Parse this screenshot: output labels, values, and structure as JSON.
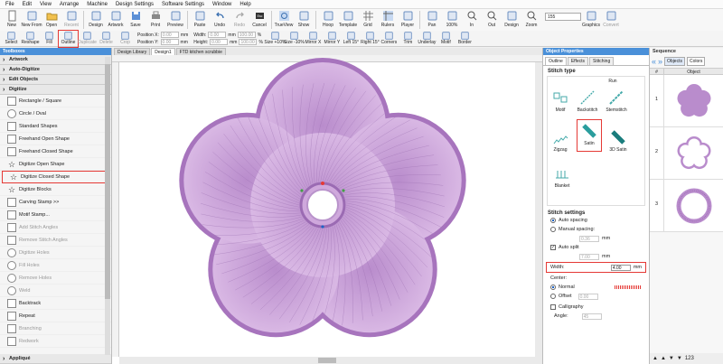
{
  "menu": [
    "File",
    "Edit",
    "View",
    "Arrange",
    "Machine",
    "Design Settings",
    "Software Settings",
    "Window",
    "Help"
  ],
  "ribbon": {
    "tools": [
      {
        "label": "New",
        "icon": "new-doc-icon"
      },
      {
        "label": "New From",
        "icon": "new-from-icon"
      },
      {
        "label": "Open",
        "icon": "open-folder-icon"
      },
      {
        "label": "Recent",
        "icon": "recent-icon"
      },
      {
        "label": "Design",
        "icon": "design-icon"
      },
      {
        "label": "Artwork",
        "icon": "artwork-icon"
      },
      {
        "label": "Save",
        "icon": "save-icon"
      },
      {
        "label": "Print",
        "icon": "print-icon"
      },
      {
        "label": "Preview",
        "icon": "preview-icon"
      },
      {
        "label": "Paste",
        "icon": "paste-icon"
      },
      {
        "label": "Undo",
        "icon": "undo-icon"
      },
      {
        "label": "Redo",
        "icon": "redo-icon"
      },
      {
        "label": "Cancel",
        "icon": "cancel-icon"
      },
      {
        "label": "TrueView",
        "icon": "trueview-icon"
      },
      {
        "label": "Show",
        "icon": "show-icon"
      },
      {
        "label": "Hoop",
        "icon": "hoop-icon"
      },
      {
        "label": "Template",
        "icon": "template-icon"
      },
      {
        "label": "Grid",
        "icon": "grid-icon"
      },
      {
        "label": "Rulers",
        "icon": "rulers-icon"
      },
      {
        "label": "Player",
        "icon": "player-icon"
      },
      {
        "label": "Pan",
        "icon": "pan-icon"
      },
      {
        "label": "100%",
        "icon": "zoom-100-icon"
      },
      {
        "label": "In",
        "icon": "zoom-in-icon"
      },
      {
        "label": "Out",
        "icon": "zoom-out-icon"
      },
      {
        "label": "Design",
        "icon": "zoom-design-icon"
      },
      {
        "label": "Zoom",
        "icon": "zoom-icon"
      }
    ],
    "zoom_value": "155",
    "extra_tools": [
      {
        "label": "Graphics",
        "icon": "graphics-icon"
      },
      {
        "label": "Convert",
        "icon": "convert-icon"
      }
    ]
  },
  "ribbon2": {
    "tools": [
      {
        "label": "Select",
        "icon": "select-arrow-icon"
      },
      {
        "label": "Reshape",
        "icon": "reshape-icon"
      },
      {
        "label": "Fill",
        "icon": "fill-icon"
      },
      {
        "label": "Outline",
        "icon": "outline-icon"
      },
      {
        "label": "Duplicate",
        "icon": "duplicate-icon"
      },
      {
        "label": "Delete",
        "icon": "delete-icon"
      },
      {
        "label": "Crop",
        "icon": "crop-icon"
      }
    ],
    "position_x_label": "Position X:",
    "position_x": "0.00",
    "position_y_label": "Position Y:",
    "position_y": "0.00",
    "width_label": "Width:",
    "width": "0.00",
    "height_label": "Height:",
    "height": "0.00",
    "unit": "mm",
    "pct_w": "100.00",
    "pct_h": "100.00",
    "pct_unit": "%",
    "tools2": [
      {
        "label": "Size +10%",
        "icon": "size-up-icon"
      },
      {
        "label": "Size -10%",
        "icon": "size-down-icon"
      },
      {
        "label": "Mirror X",
        "icon": "mirror-x-icon"
      },
      {
        "label": "Mirror Y",
        "icon": "mirror-y-icon"
      },
      {
        "label": "Left 15°",
        "icon": "rotate-left-icon"
      },
      {
        "label": "Right 15°",
        "icon": "rotate-right-icon"
      },
      {
        "label": "Corners",
        "icon": "corners-icon"
      },
      {
        "label": "Trim",
        "icon": "trim-icon"
      },
      {
        "label": "Underlay",
        "icon": "underlay-icon"
      },
      {
        "label": "Motif",
        "icon": "motif-icon"
      },
      {
        "label": "Border",
        "icon": "border-icon"
      }
    ]
  },
  "toolbox": {
    "title": "Toolboxes",
    "groups": [
      "Artwork",
      "Auto-Digitize",
      "Edit Objects",
      "Digitize"
    ],
    "items": [
      {
        "label": "Rectangle / Square",
        "enabled": true
      },
      {
        "label": "Circle / Oval",
        "enabled": true
      },
      {
        "label": "Standard Shapes",
        "enabled": true
      },
      {
        "label": "Freehand Open Shape",
        "enabled": true
      },
      {
        "label": "Freehand Closed Shape",
        "enabled": true
      },
      {
        "label": "Digitize Open Shape",
        "enabled": true
      },
      {
        "label": "Digitize Closed Shape",
        "enabled": true
      },
      {
        "label": "Digitize Blocks",
        "enabled": true
      },
      {
        "label": "Carving Stamp >>",
        "enabled": true
      },
      {
        "label": "Motif Stamp...",
        "enabled": true
      },
      {
        "label": "Add Stitch Angles",
        "enabled": false
      },
      {
        "label": "Remove Stitch Angles",
        "enabled": false
      },
      {
        "label": "Digitize Holes",
        "enabled": false
      },
      {
        "label": "Fill Holes",
        "enabled": false
      },
      {
        "label": "Remove Holes",
        "enabled": false
      },
      {
        "label": "Weld",
        "enabled": false
      },
      {
        "label": "Backtrack",
        "enabled": true
      },
      {
        "label": "Repeat",
        "enabled": true
      },
      {
        "label": "Branching",
        "enabled": false
      },
      {
        "label": "Redwork",
        "enabled": false
      }
    ],
    "footer_group": "Appliqué"
  },
  "doc_tabs": [
    "Design Library",
    "Design1",
    "FTD kitchen scrubbie"
  ],
  "object_properties": {
    "title": "Object Properties",
    "tabs": [
      "Outline",
      "Effects",
      "Stitching"
    ],
    "stitch_type_heading": "Stitch type",
    "stitch_types": [
      "Run",
      "Motif",
      "Backstitch",
      "Stemstitch",
      "Zigzag",
      "Satin",
      "3D Satin",
      "Blanket"
    ],
    "stitch_settings_heading": "Stitch settings",
    "auto_spacing": "Auto spacing",
    "manual_spacing": "Manual spacing:",
    "manual_spacing_value": "0.36",
    "auto_split": "Auto split",
    "auto_split_value": "7.00",
    "width_label": "Width:",
    "width_value": "4.00",
    "mm": "mm",
    "center_label": "Center:",
    "normal": "Normal",
    "offset": "Offset",
    "offset_value": "0.00",
    "calligraphy": "Calligraphy",
    "angle_label": "Angle:",
    "angle_value": "45"
  },
  "sequence": {
    "title": "Sequence",
    "btn_objects": "Objects",
    "btn_colors": "Colors",
    "col_num": "#",
    "col_object": "Object",
    "rows": [
      "1",
      "2",
      "3"
    ],
    "footer_count": "123"
  },
  "colors": {
    "accent": "#4a90d9",
    "thread": "#c9a3d6",
    "thread_dark": "#a774bd",
    "highlight": "#e53935"
  }
}
